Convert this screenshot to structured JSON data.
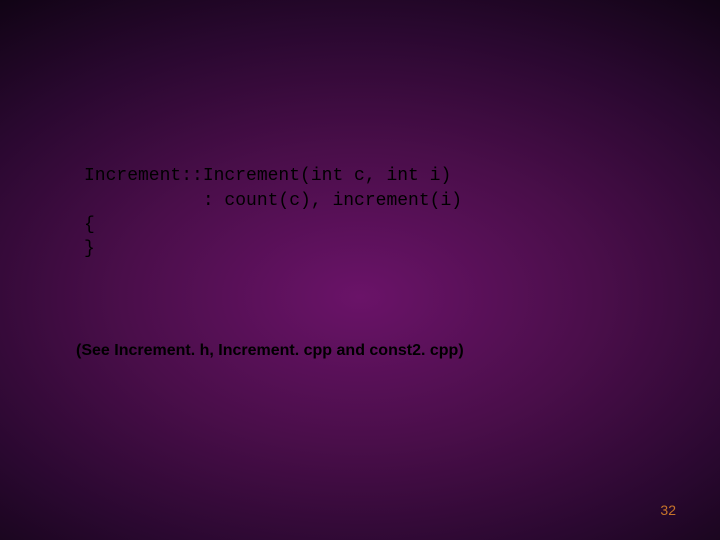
{
  "code": {
    "line1": "Increment::Increment(int c, int i)",
    "line2": "           : count(c), increment(i)",
    "line3": "{",
    "line4": "}"
  },
  "note": "(See Increment. h, Increment. cpp and const2. cpp)",
  "page_number": "32"
}
